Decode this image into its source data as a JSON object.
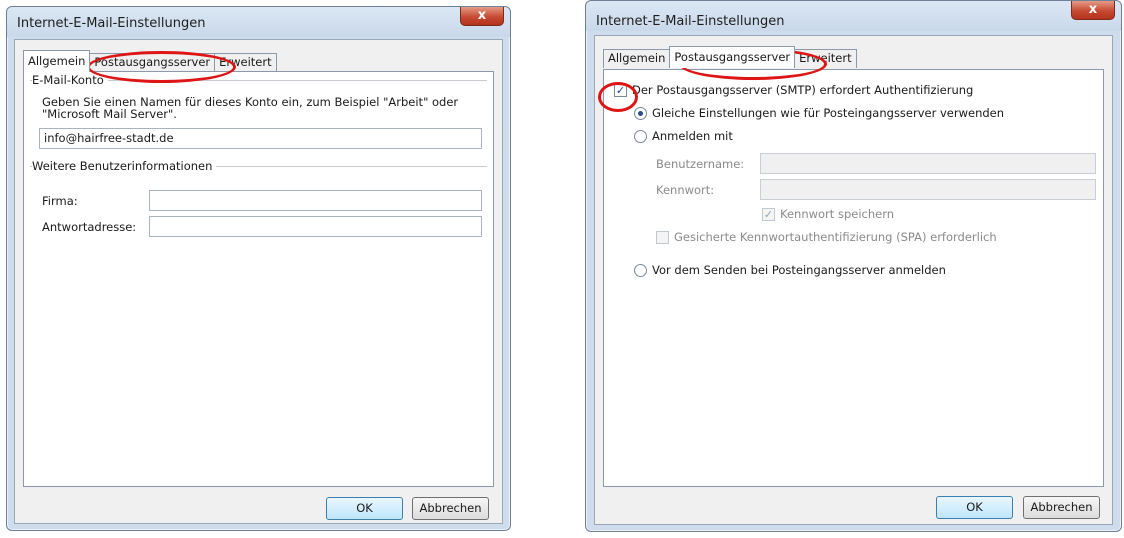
{
  "colors": {
    "annotation": "#dd1515",
    "window_frame": "#cfdcec",
    "close_button": "#c74a33"
  },
  "left_dialog": {
    "title": "Internet-E-Mail-Einstellungen",
    "close_label": "x",
    "tabs": [
      "Allgemein",
      "Postausgangsserver",
      "Erweitert"
    ],
    "active_tab": "Allgemein",
    "account_group": "E-Mail-Konto",
    "account_hint_line1": "Geben Sie einen Namen für dieses Konto ein, zum Beispiel \"Arbeit\" oder",
    "account_hint_line2": "\"Microsoft Mail Server\".",
    "account_name": "info@hairfree-stadt.de",
    "user_group": "Weitere Benutzerinformationen",
    "company_label": "Firma:",
    "company_value": "",
    "reply_label": "Antwortadresse:",
    "reply_value": "",
    "ok_label": "OK",
    "cancel_label": "Abbrechen"
  },
  "right_dialog": {
    "title": "Internet-E-Mail-Einstellungen",
    "close_label": "x",
    "tabs": [
      "Allgemein",
      "Postausgangsserver",
      "Erweitert"
    ],
    "active_tab": "Postausgangsserver",
    "smtp_auth_label": "Der Postausgangsserver (SMTP) erfordert Authentifizierung",
    "smtp_auth_checked": true,
    "same_settings_label": "Gleiche Einstellungen wie für Posteingangsserver verwenden",
    "login_with_label": "Anmelden mit",
    "username_label": "Benutzername:",
    "username_value": "",
    "password_label": "Kennwort:",
    "password_value": "",
    "save_password_label": "Kennwort speichern",
    "spa_label": "Gesicherte Kennwortauthentifizierung (SPA) erforderlich",
    "login_before_send_label": "Vor dem Senden bei Posteingangsserver anmelden",
    "ok_label": "OK",
    "cancel_label": "Abbrechen"
  }
}
